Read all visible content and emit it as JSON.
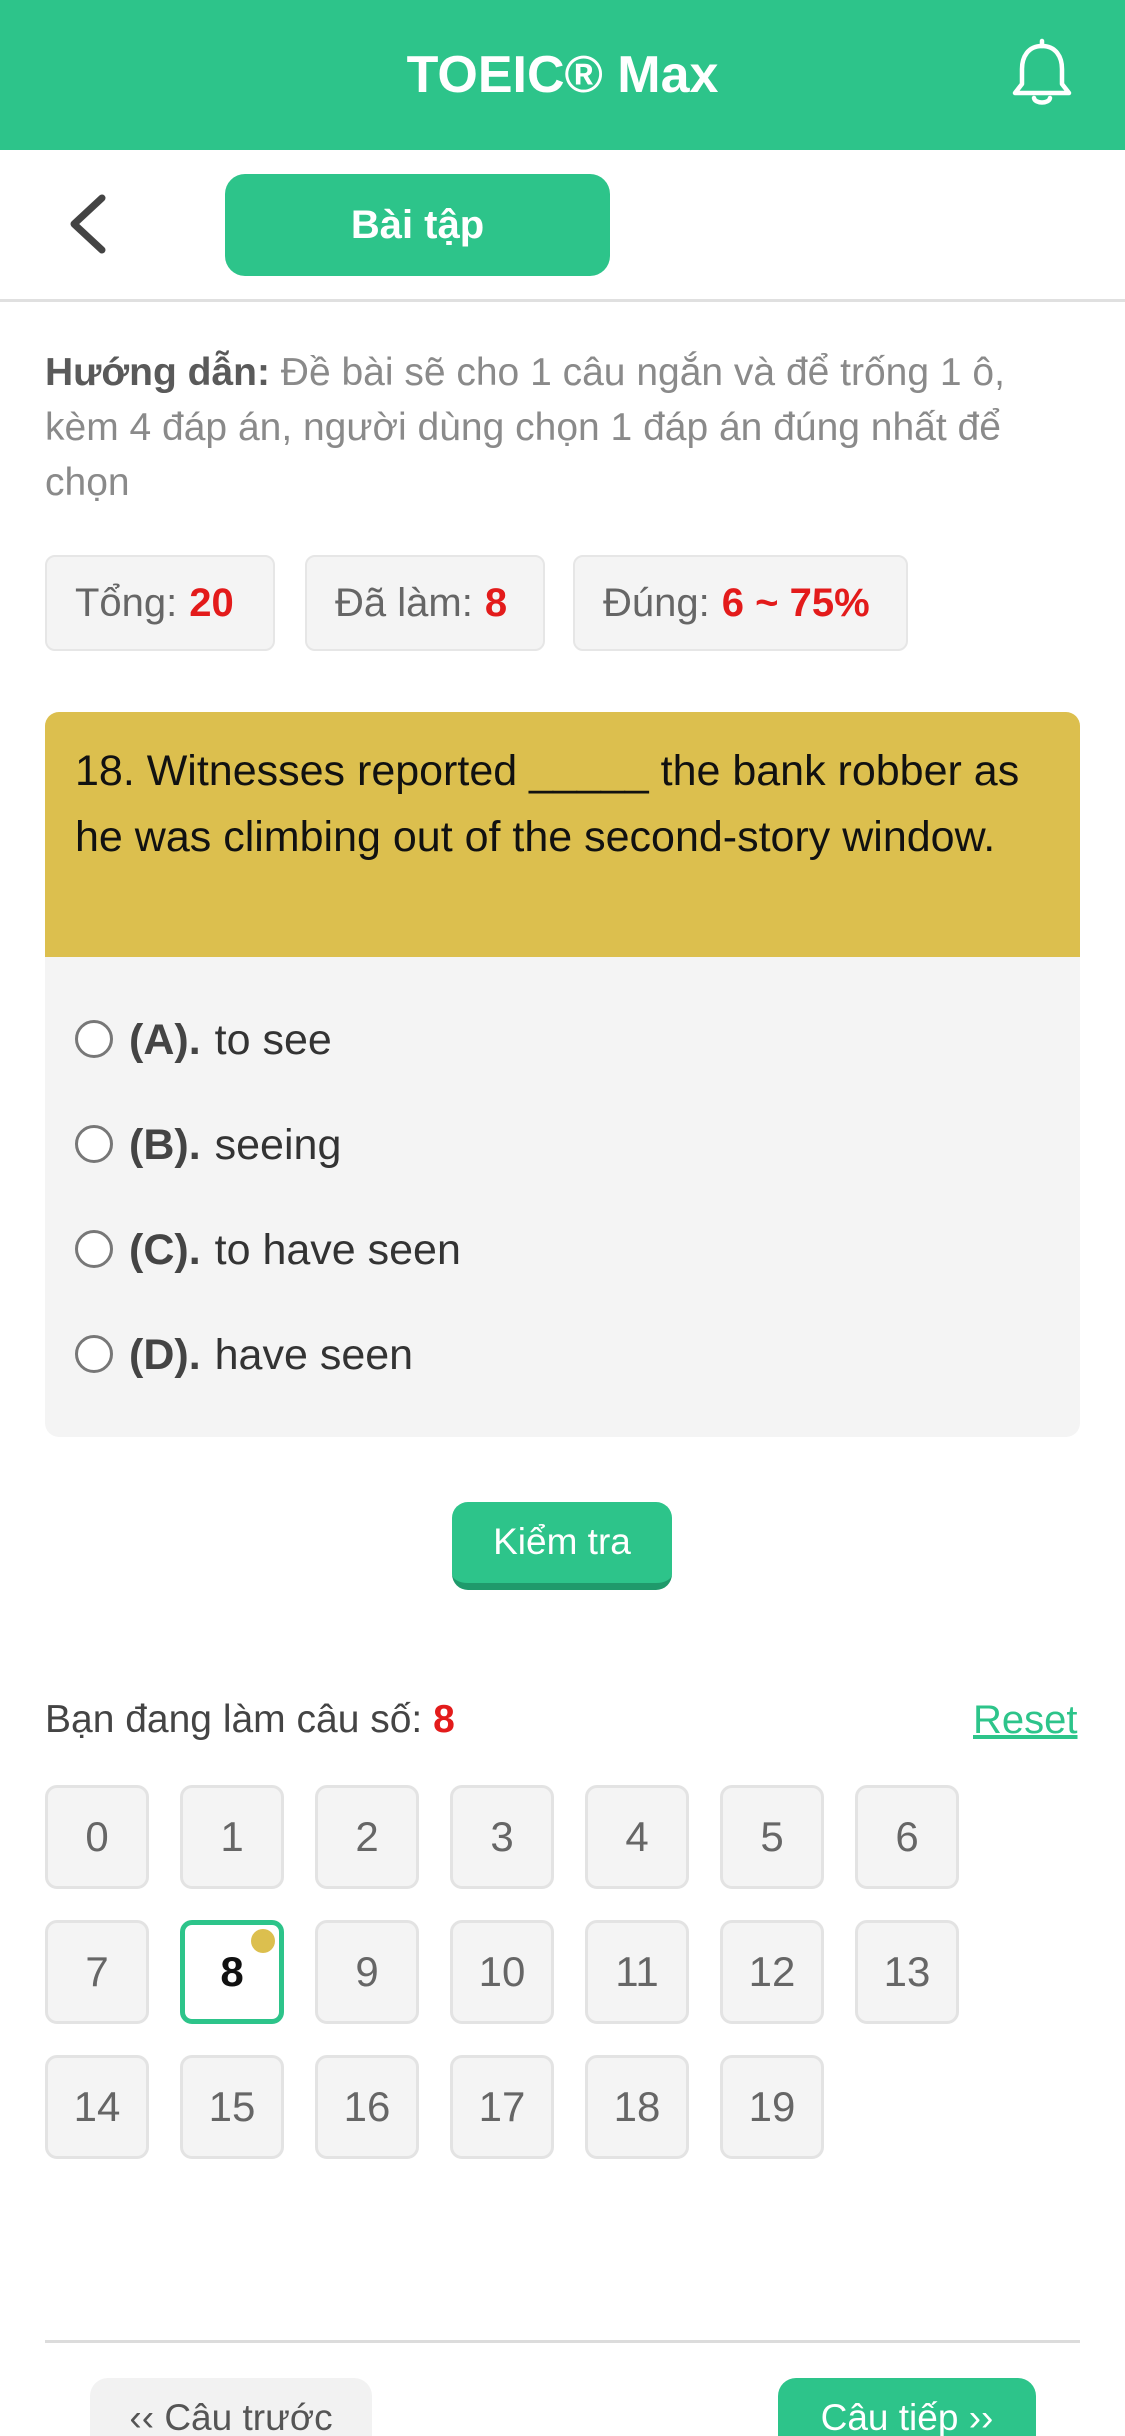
{
  "header": {
    "app_title": "TOEIC® Max",
    "accent_color": "#2dc48a",
    "notification_icon": "bell-icon"
  },
  "subheader": {
    "back_icon": "chevron-left-icon",
    "tab_label": "Bài tập"
  },
  "guide": {
    "label": "Hướng dẫn:",
    "text": " Đề bài sẽ cho 1 câu ngắn và để trống 1 ô, kèm 4 đáp án, người dùng chọn 1 đáp án đúng nhất để chọn"
  },
  "stats": {
    "total_label": "Tổng:",
    "total_value": "20",
    "done_label": "Đã làm:",
    "done_value": "8",
    "correct_label": "Đúng:",
    "correct_value": "6 ~ 75%"
  },
  "question": {
    "text": "18. Witnesses reported _____ the bank robber as he was climbing out of the second-story window.",
    "header_color": "#dcbf4e",
    "options": [
      {
        "label": "(A).",
        "text": "to see"
      },
      {
        "label": "(B).",
        "text": "seeing"
      },
      {
        "label": "(C).",
        "text": "to have seen"
      },
      {
        "label": "(D).",
        "text": "have seen"
      }
    ]
  },
  "check_button": "Kiểm tra",
  "navigator": {
    "doing_label": "Bạn đang làm câu số:",
    "doing_value": "8",
    "reset_label": "Reset",
    "current": 8,
    "numbers": [
      "0",
      "1",
      "2",
      "3",
      "4",
      "5",
      "6",
      "7",
      "8",
      "9",
      "10",
      "11",
      "12",
      "13",
      "14",
      "15",
      "16",
      "17",
      "18",
      "19"
    ]
  },
  "footer": {
    "prev_label": "‹‹ Câu trước",
    "next_label": "Câu tiếp ››"
  }
}
